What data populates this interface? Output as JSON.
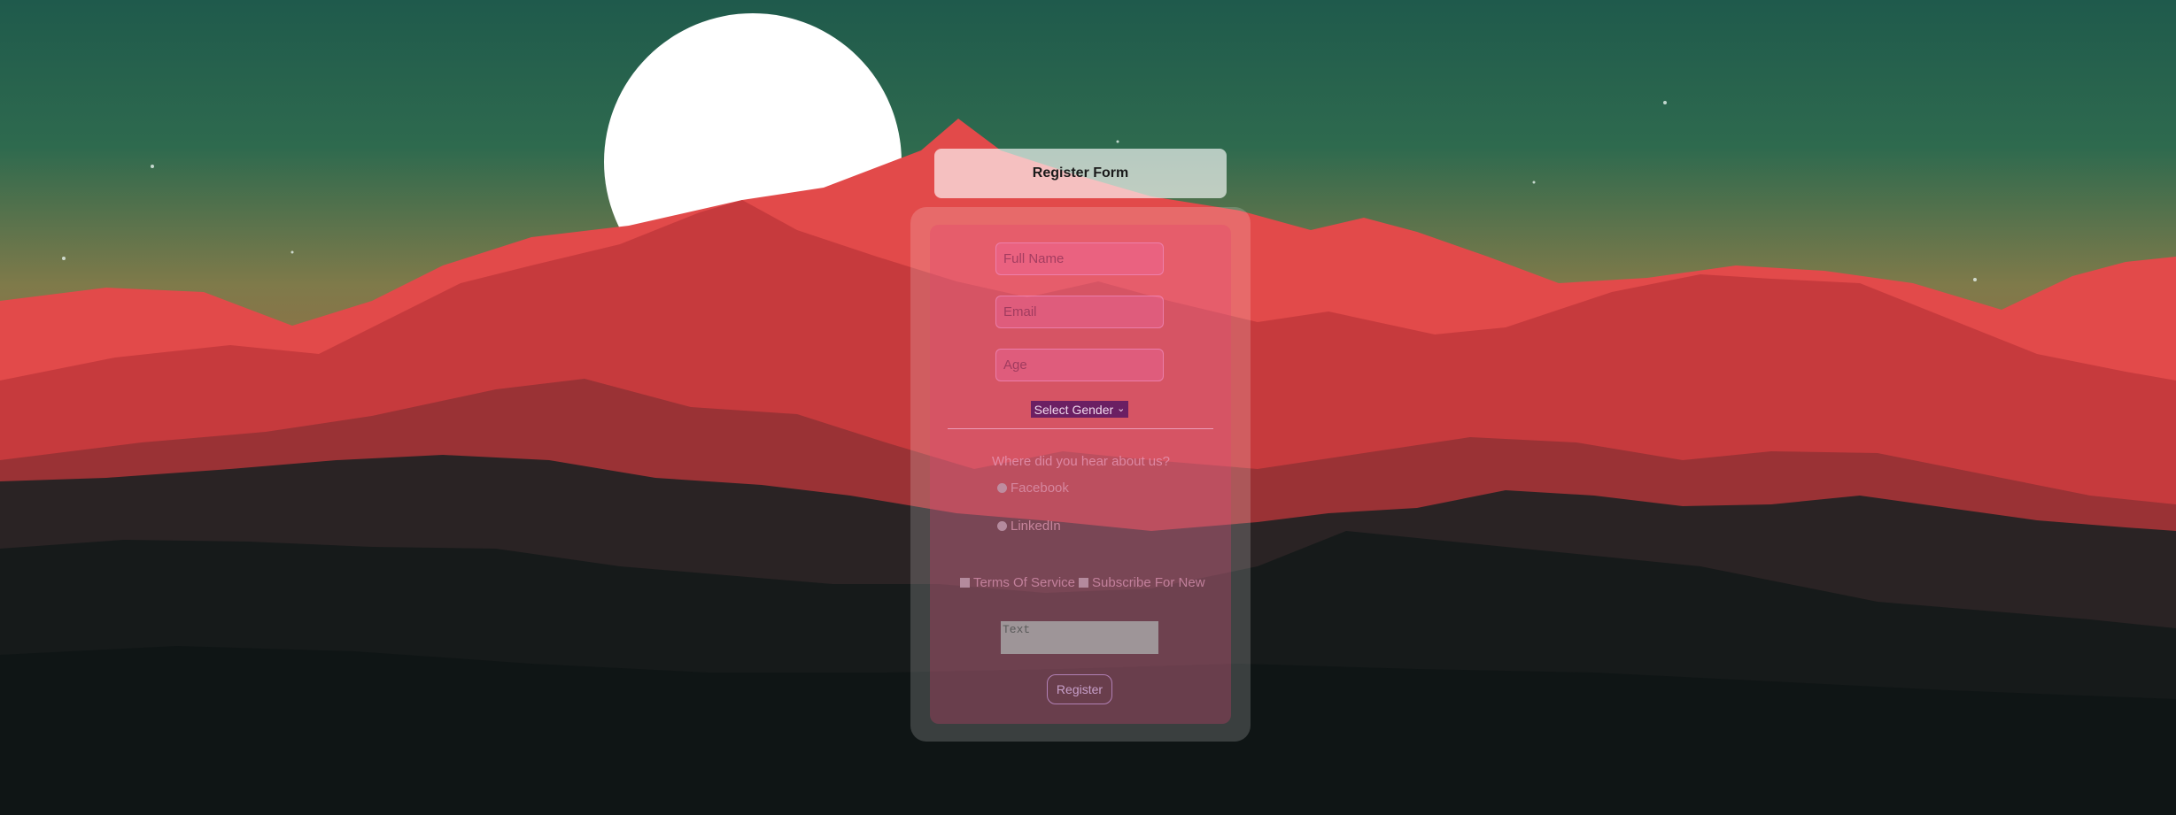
{
  "header": {
    "title": "Register Form"
  },
  "fields": {
    "full_name": {
      "placeholder": "Full Name"
    },
    "email": {
      "placeholder": "Email"
    },
    "age": {
      "placeholder": "Age"
    }
  },
  "gender": {
    "selected": "Select Gender"
  },
  "source_question": {
    "label": "Where did you hear about us?",
    "options": [
      "Facebook",
      "LinkedIn"
    ]
  },
  "checkboxes": {
    "terms": "Terms Of Service",
    "subscribe": "Subscribe For New"
  },
  "comments": {
    "placeholder": "Text"
  },
  "register_button": {
    "label": "Register"
  },
  "colors": {
    "sky_top": "#1f5a4c",
    "sky_mid": "#7f7a4a",
    "mountain_red": "#e24a4a",
    "dark_hills": "#141818",
    "moon": "#ffffff"
  }
}
